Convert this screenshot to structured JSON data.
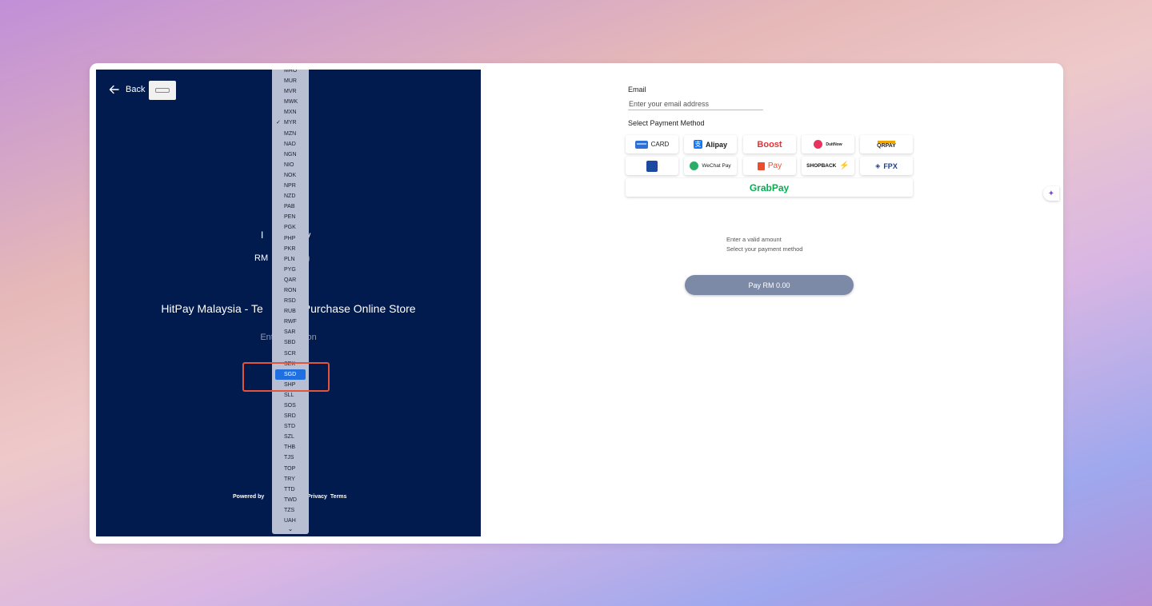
{
  "left": {
    "back_label": "Back",
    "pay_to_prefix": "I",
    "pay_to_suffix": "pay",
    "amount_prefix": "RM",
    "amount_value": "0",
    "store_name": "HitPay Malaysia - Te",
    "store_name_tail": "Purchase Online Store",
    "description_hint": "Ent",
    "description_hint_tail": "ption",
    "powered_by": "Powered by",
    "privacy": "Privacy",
    "terms": "Terms"
  },
  "dropdown": {
    "items": [
      "MRO",
      "MUR",
      "MVR",
      "MWK",
      "MXN",
      "MYR",
      "MZN",
      "NAD",
      "NGN",
      "NIO",
      "NOK",
      "NPR",
      "NZD",
      "PAB",
      "PEN",
      "PGK",
      "PHP",
      "PKR",
      "PLN",
      "PYG",
      "QAR",
      "RON",
      "RSD",
      "RUB",
      "RWF",
      "SAR",
      "SBD",
      "SCR",
      "SEK",
      "SGD",
      "SHP",
      "SLL",
      "SOS",
      "SRD",
      "STD",
      "SZL",
      "THB",
      "TJS",
      "TOP",
      "TRY",
      "TTD",
      "TWD",
      "TZS",
      "UAH"
    ],
    "selected": "MYR",
    "highlighted": "SGD",
    "chevron": "⌄"
  },
  "right": {
    "email_label": "Email",
    "email_placeholder": "Enter your email address",
    "payment_method_label": "Select Payment Method",
    "methods": {
      "card": "CARD",
      "alipay": "Alipay",
      "boost": "Boost",
      "duitnow": "DuitNow",
      "duitnow_qr": "QRPAY",
      "tng": "Touch 'n Go eWallet",
      "wechat": "WeChat Pay",
      "shopee": "Pay",
      "shopback": "SHOPBACK",
      "fpx": "FPX",
      "grabpay": "GrabPay"
    },
    "hint_amount": "Enter a valid amount",
    "hint_method": "Select your payment method",
    "pay_button": "Pay RM 0.00"
  },
  "colors": {
    "left_panel_bg": "#011b4f",
    "dropdown_bg": "#b9bfd2",
    "highlight": "#1f6fe0",
    "annotation_red": "#e2553d",
    "pay_button_bg": "#7d8aa7",
    "grabpay_green": "#00b14f"
  }
}
